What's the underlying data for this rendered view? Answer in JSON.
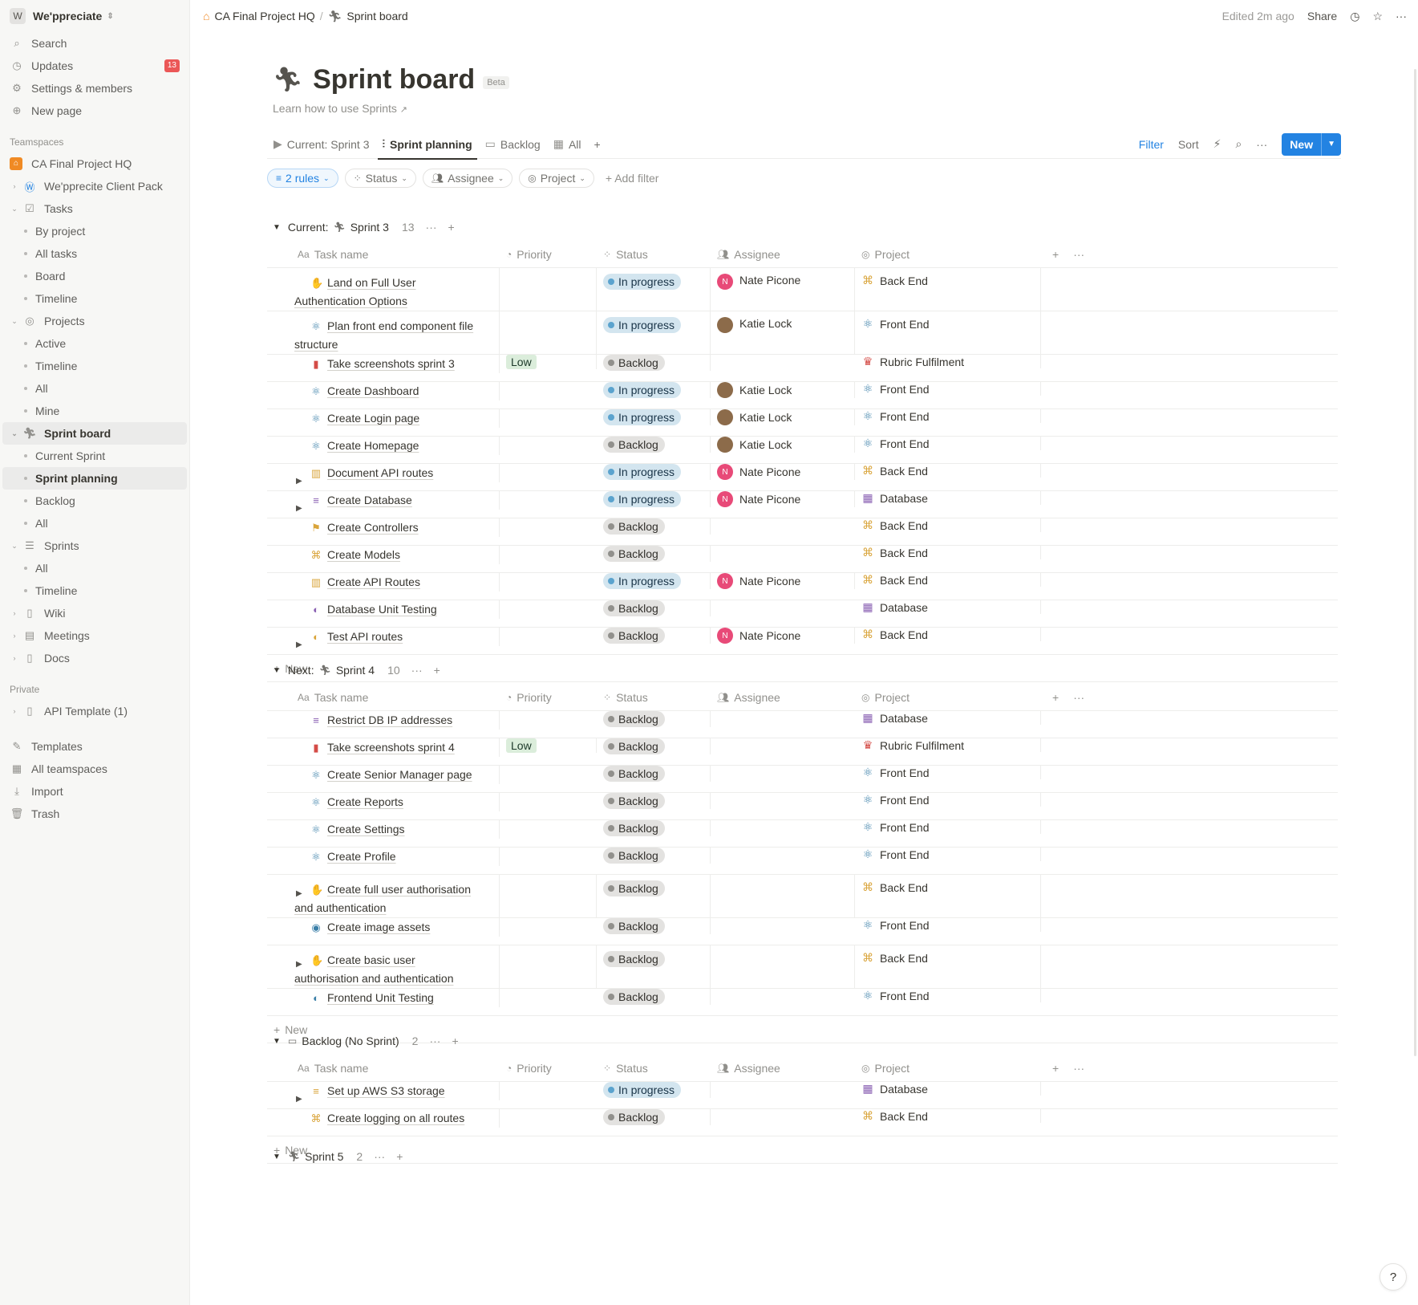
{
  "workspace": {
    "logo": "W",
    "name": "We'ppreciate"
  },
  "sidebar": {
    "top": [
      {
        "icon": "⌕",
        "label": "Search"
      },
      {
        "icon": "◷",
        "label": "Updates",
        "badge": "13"
      },
      {
        "icon": "⚙",
        "label": "Settings & members"
      },
      {
        "icon": "⊕",
        "label": "New page"
      }
    ],
    "teamspaces_label": "Teamspaces",
    "teamspace": "CA Final Project HQ",
    "client_pack": "We'pprecite Client Pack",
    "tasks": "Tasks",
    "tasks_items": [
      "By project",
      "All tasks",
      "Board",
      "Timeline"
    ],
    "projects": "Projects",
    "projects_items": [
      "Active",
      "Timeline",
      "All",
      "Mine"
    ],
    "sprint_board": "Sprint board",
    "sprint_items": [
      "Current Sprint",
      "Sprint planning",
      "Backlog",
      "All"
    ],
    "sprints": "Sprints",
    "sprints_items": [
      "All",
      "Timeline"
    ],
    "wiki": "Wiki",
    "meetings": "Meetings",
    "docs": "Docs",
    "private_label": "Private",
    "api_template": "API Template (1)",
    "bottom": [
      "Templates",
      "All teamspaces",
      "Import",
      "Trash"
    ]
  },
  "topbar": {
    "crumb1": "CA Final Project HQ",
    "crumb_sep": "/",
    "crumb2": "Sprint board",
    "edited": "Edited 2m ago",
    "share": "Share"
  },
  "page": {
    "title": "Sprint board",
    "beta": "Beta",
    "learn": "Learn how to use Sprints"
  },
  "views": {
    "tabs": [
      "Current: Sprint 3",
      "Sprint planning",
      "Backlog",
      "All"
    ],
    "filter": "Filter",
    "sort": "Sort",
    "new": "New"
  },
  "filters": {
    "rules": "2 rules",
    "status": "Status",
    "assignee": "Assignee",
    "project": "Project",
    "add": "Add filter"
  },
  "columns": {
    "name": "Task name",
    "priority": "Priority",
    "status": "Status",
    "assignee": "Assignee",
    "project": "Project"
  },
  "new_label": "New",
  "groups": [
    {
      "prefix": "Current:",
      "name": "Sprint 3",
      "count": "13",
      "rows": [
        {
          "icon": "✋",
          "icolor": "#d9a43a",
          "name1": "Land on Full User",
          "name2": "Authentication Options",
          "status": "In progress",
          "assignee": "Nate Picone",
          "project": "Back End"
        },
        {
          "icon": "⚛",
          "icolor": "#3a7fa8",
          "name1": "Plan front end component file",
          "name2": "structure",
          "status": "In progress",
          "assignee": "Katie Lock",
          "project": "Front End"
        },
        {
          "icon": "▮",
          "icolor": "#d44c47",
          "name1": "Take screenshots sprint 3",
          "priority": "Low",
          "status": "Backlog",
          "project": "Rubric Fulfilment"
        },
        {
          "icon": "⚛",
          "icolor": "#3a7fa8",
          "name1": "Create Dashboard",
          "status": "In progress",
          "assignee": "Katie Lock",
          "project": "Front End"
        },
        {
          "icon": "⚛",
          "icolor": "#3a7fa8",
          "name1": "Create Login page",
          "status": "In progress",
          "assignee": "Katie Lock",
          "project": "Front End"
        },
        {
          "icon": "⚛",
          "icolor": "#3a7fa8",
          "name1": "Create Homepage",
          "status": "Backlog",
          "assignee": "Katie Lock",
          "project": "Front End"
        },
        {
          "icon": "▥",
          "icolor": "#d9a43a",
          "expand": true,
          "name1": "Document API routes",
          "status": "In progress",
          "assignee": "Nate Picone",
          "project": "Back End"
        },
        {
          "icon": "≡",
          "icolor": "#8a61b3",
          "expand": true,
          "name1": "Create Database",
          "status": "In progress",
          "assignee": "Nate Picone",
          "project": "Database"
        },
        {
          "icon": "⚑",
          "icolor": "#d9a43a",
          "name1": "Create Controllers",
          "status": "Backlog",
          "project": "Back End"
        },
        {
          "icon": "⌘",
          "icolor": "#d9a43a",
          "name1": "Create Models",
          "status": "Backlog",
          "project": "Back End"
        },
        {
          "icon": "▥",
          "icolor": "#d9a43a",
          "name1": "Create API Routes",
          "status": "In progress",
          "assignee": "Nate Picone",
          "project": "Back End"
        },
        {
          "icon": "◐",
          "icolor": "#8a61b3",
          "name1": "Database Unit Testing",
          "status": "Backlog",
          "project": "Database"
        },
        {
          "icon": "◐",
          "icolor": "#d9a43a",
          "expand": true,
          "name1": "Test API routes",
          "status": "Backlog",
          "assignee": "Nate Picone",
          "project": "Back End"
        }
      ]
    },
    {
      "prefix": "Next:",
      "name": "Sprint 4",
      "count": "10",
      "rows": [
        {
          "icon": "≡",
          "icolor": "#8a61b3",
          "name1": "Restrict DB IP addresses",
          "status": "Backlog",
          "project": "Database"
        },
        {
          "icon": "▮",
          "icolor": "#d44c47",
          "name1": "Take screenshots sprint 4",
          "priority": "Low",
          "status": "Backlog",
          "project": "Rubric Fulfilment"
        },
        {
          "icon": "⚛",
          "icolor": "#3a7fa8",
          "name1": "Create Senior Manager page",
          "status": "Backlog",
          "project": "Front End"
        },
        {
          "icon": "⚛",
          "icolor": "#3a7fa8",
          "name1": "Create Reports",
          "status": "Backlog",
          "project": "Front End"
        },
        {
          "icon": "⚛",
          "icolor": "#3a7fa8",
          "name1": "Create Settings",
          "status": "Backlog",
          "project": "Front End"
        },
        {
          "icon": "⚛",
          "icolor": "#3a7fa8",
          "name1": "Create Profile",
          "status": "Backlog",
          "project": "Front End"
        },
        {
          "icon": "✋",
          "icolor": "#d9a43a",
          "expand": true,
          "name1": "Create full user authorisation",
          "name2": "and authentication",
          "status": "Backlog",
          "project": "Back End"
        },
        {
          "icon": "◉",
          "icolor": "#3a7fa8",
          "name1": "Create image assets",
          "status": "Backlog",
          "project": "Front End"
        },
        {
          "icon": "✋",
          "icolor": "#d9a43a",
          "expand": true,
          "name1": "Create basic user",
          "name2": "authorisation and authentication",
          "status": "Backlog",
          "project": "Back End"
        },
        {
          "icon": "◐",
          "icolor": "#3a7fa8",
          "name1": "Frontend Unit Testing",
          "status": "Backlog",
          "project": "Front End"
        }
      ]
    },
    {
      "prefix": "",
      "name": "Backlog (No Sprint)",
      "count": "2",
      "rows": [
        {
          "icon": "≡",
          "icolor": "#d9a43a",
          "expand": true,
          "name1": "Set up AWS S3 storage",
          "status": "In progress",
          "project": "Database"
        },
        {
          "icon": "⌘",
          "icolor": "#d9a43a",
          "name1": "Create logging on all routes",
          "status": "Backlog",
          "project": "Back End"
        }
      ]
    }
  ],
  "group_last": {
    "name": "Sprint 5",
    "count": "2"
  },
  "help": "?"
}
